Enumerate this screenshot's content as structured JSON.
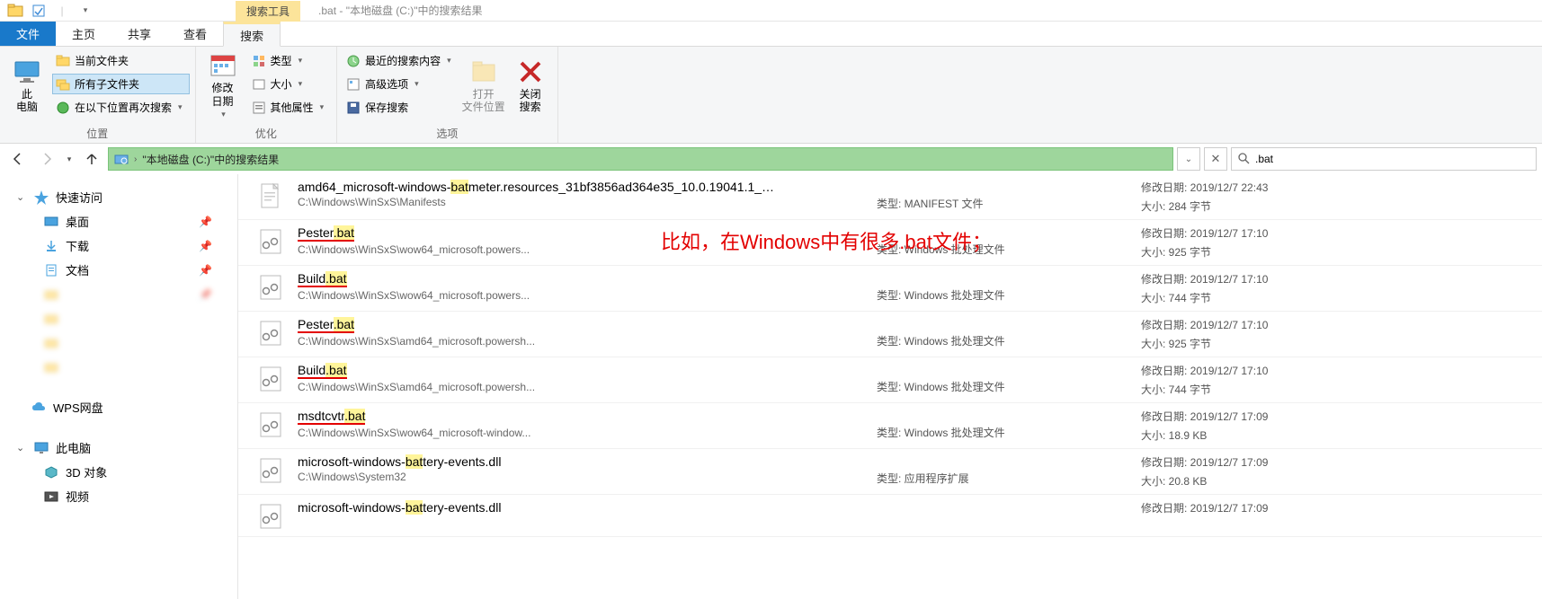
{
  "titlebar": {
    "context_tab": "搜索工具",
    "window_title": ".bat - \"本地磁盘 (C:)\"中的搜索结果"
  },
  "tabs": {
    "file": "文件",
    "home": "主页",
    "share": "共享",
    "view": "查看",
    "search": "搜索"
  },
  "ribbon": {
    "loc_group": "位置",
    "this_pc": "此\n电脑",
    "current_folder": "当前文件夹",
    "all_subfolders": "所有子文件夹",
    "search_again_in": "在以下位置再次搜索",
    "refine_group": "优化",
    "date_modified": "修改\n日期",
    "kind": "类型",
    "size": "大小",
    "other_props": "其他属性",
    "options_group": "选项",
    "recent_searches": "最近的搜索内容",
    "advanced_options": "高级选项",
    "save_search": "保存搜索",
    "open_location": "打开\n文件位置",
    "close_search": "关闭\n搜索"
  },
  "nav": {
    "breadcrumb": "\"本地磁盘 (C:)\"中的搜索结果",
    "search_value": ".bat"
  },
  "navpane": {
    "quick_access": "快速访问",
    "desktop": "桌面",
    "downloads": "下载",
    "documents": "文档",
    "wps": "WPS网盘",
    "this_pc": "此电脑",
    "objects_3d": "3D 对象",
    "videos": "视频"
  },
  "meta_labels": {
    "type": "类型:",
    "date_modified": "修改日期:",
    "size": "大小:"
  },
  "results": [
    {
      "name_pre": "amd64_microsoft-windows-",
      "name_hl": "bat",
      "name_post": "meter.resources_31bf3856ad364e35_10.0.19041.1_…",
      "path": "C:\\Windows\\WinSxS\\Manifests",
      "type": "MANIFEST 文件",
      "date": "2019/12/7 22:43",
      "size": "284 字节",
      "icon": "file",
      "underline": false
    },
    {
      "name_pre": "Pester",
      "name_hl": ".bat",
      "name_post": "",
      "path": "C:\\Windows\\WinSxS\\wow64_microsoft.powers...",
      "type": "Windows 批处理文件",
      "date": "2019/12/7 17:10",
      "size": "925 字节",
      "icon": "bat",
      "underline": true
    },
    {
      "name_pre": "Build",
      "name_hl": ".bat",
      "name_post": "",
      "path": "C:\\Windows\\WinSxS\\wow64_microsoft.powers...",
      "type": "Windows 批处理文件",
      "date": "2019/12/7 17:10",
      "size": "744 字节",
      "icon": "bat",
      "underline": true
    },
    {
      "name_pre": "Pester",
      "name_hl": ".bat",
      "name_post": "",
      "path": "C:\\Windows\\WinSxS\\amd64_microsoft.powersh...",
      "type": "Windows 批处理文件",
      "date": "2019/12/7 17:10",
      "size": "925 字节",
      "icon": "bat",
      "underline": true
    },
    {
      "name_pre": "Build",
      "name_hl": ".bat",
      "name_post": "",
      "path": "C:\\Windows\\WinSxS\\amd64_microsoft.powersh...",
      "type": "Windows 批处理文件",
      "date": "2019/12/7 17:10",
      "size": "744 字节",
      "icon": "bat",
      "underline": true
    },
    {
      "name_pre": "msdtcvtr",
      "name_hl": ".bat",
      "name_post": "",
      "path": "C:\\Windows\\WinSxS\\wow64_microsoft-window...",
      "type": "Windows 批处理文件",
      "date": "2019/12/7 17:09",
      "size": "18.9 KB",
      "icon": "bat",
      "underline": true
    },
    {
      "name_pre": "microsoft-windows-",
      "name_hl": "bat",
      "name_post": "tery-events.dll",
      "path": "C:\\Windows\\System32",
      "type": "应用程序扩展",
      "date": "2019/12/7 17:09",
      "size": "20.8 KB",
      "icon": "dll",
      "underline": false
    },
    {
      "name_pre": "microsoft-windows-",
      "name_hl": "bat",
      "name_post": "tery-events.dll",
      "path": "",
      "type": "",
      "date": "2019/12/7 17:09",
      "size": "",
      "icon": "dll",
      "underline": false
    }
  ],
  "annotation": "比如，在Windows中有很多.bat文件；"
}
